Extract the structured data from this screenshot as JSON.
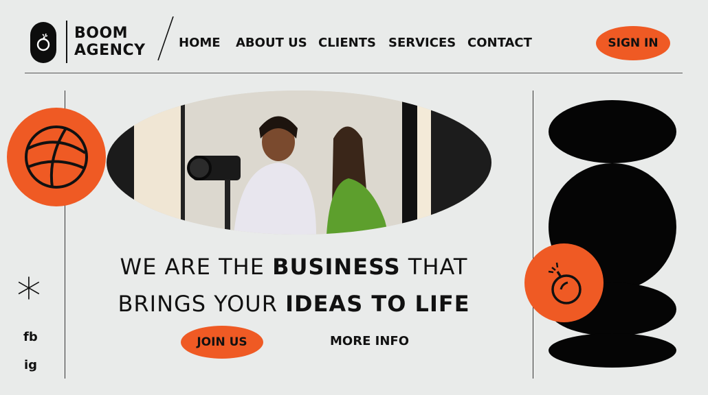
{
  "brand": {
    "line1": "BOOM",
    "line2": "AGENCY"
  },
  "nav": {
    "items": [
      "HOME",
      "ABOUT US",
      "CLIENTS",
      "SERVICES",
      "CONTACT"
    ]
  },
  "header": {
    "signin_label": "SIGN IN"
  },
  "hero": {
    "headline_line1_regular": "WE ARE THE",
    "headline_line1_bold": "BUSINESS",
    "headline_line1_end": "THAT",
    "headline_line2_regular": "BRINGS YOUR",
    "headline_line2_bold": "IDEAS TO LIFE",
    "join_label": "JOIN US",
    "more_label": "MORE INFO"
  },
  "social": {
    "fb": "fb",
    "ig": "ig"
  },
  "sidebar": {
    "asterisk": "*"
  },
  "colors": {
    "accent": "#ef5a24",
    "background": "#e9ebea",
    "ink": "#0d0d0d"
  },
  "icons": [
    "bomb-icon",
    "globe-icon",
    "asterisk-icon"
  ]
}
